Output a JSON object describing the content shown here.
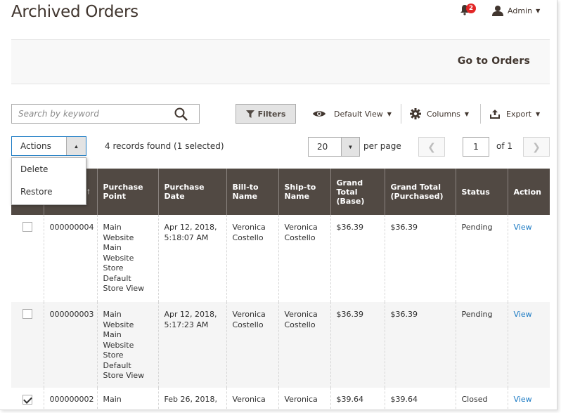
{
  "header": {
    "title": "Archived Orders",
    "notification_count": "2",
    "user_label": "Admin"
  },
  "page_actions": {
    "go_to_orders": "Go to Orders"
  },
  "toolbar": {
    "search_placeholder": "Search by keyword",
    "filters_label": "Filters",
    "view_label": "Default View",
    "columns_label": "Columns",
    "export_label": "Export"
  },
  "mass_actions": {
    "label": "Actions",
    "options": [
      "Delete",
      "Restore"
    ]
  },
  "records_found": "4 records found (1 selected)",
  "pager": {
    "per_page_value": "20",
    "per_page_label": "per page",
    "current_page": "1",
    "of_pages": "of 1"
  },
  "grid": {
    "columns": [
      "",
      "",
      "Purchase Point",
      "Purchase Date",
      "Bill-to Name",
      "Ship-to Name",
      "Grand Total (Base)",
      "Grand Total (Purchased)",
      "Status",
      "Action"
    ],
    "rows": [
      {
        "checked": false,
        "id": "000000004",
        "purchase_point": "Main Website\n   Main Website Store\n      Default Store View",
        "purchase_date": "Apr 12, 2018, 5:18:07 AM",
        "bill_to": "Veronica Costello",
        "ship_to": "Veronica Costello",
        "grand_total_base": "$36.39",
        "grand_total_purchased": "$36.39",
        "status": "Pending",
        "action": "View"
      },
      {
        "checked": false,
        "id": "000000003",
        "purchase_point": "Main Website\n   Main Website Store\n      Default Store View",
        "purchase_date": "Apr 12, 2018, 5:17:23 AM",
        "bill_to": "Veronica Costello",
        "ship_to": "Veronica Costello",
        "grand_total_base": "$36.39",
        "grand_total_purchased": "$36.39",
        "status": "Pending",
        "action": "View"
      },
      {
        "checked": true,
        "id": "000000002",
        "purchase_point": "Main",
        "purchase_date": "Feb 26, 2018,",
        "bill_to": "Veronica",
        "ship_to": "Veronica",
        "grand_total_base": "$39.64",
        "grand_total_purchased": "$39.64",
        "status": "Closed",
        "action": "View"
      }
    ]
  },
  "colors": {
    "header_bg": "#514943",
    "link": "#1979c3",
    "badge": "#e22626",
    "focus_border": "#1979c3"
  }
}
